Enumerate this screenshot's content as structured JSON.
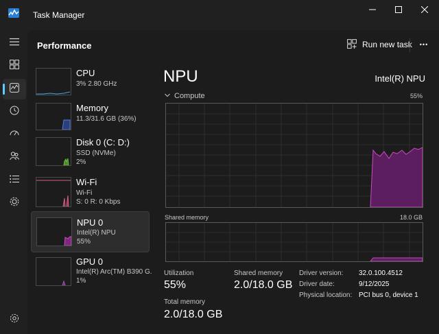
{
  "window": {
    "title": "Task Manager",
    "controls": {
      "minimize": "—",
      "maximize": "☐",
      "close": "✕"
    }
  },
  "nav": {
    "icons": [
      "hamburger-icon",
      "processes-icon",
      "performance-icon",
      "app-history-icon",
      "startup-apps-icon",
      "users-icon",
      "details-icon",
      "services-icon",
      "settings-icon"
    ],
    "active": "performance-icon"
  },
  "header": {
    "title": "Performance",
    "run_task": "Run new task",
    "more": "•••"
  },
  "devices": [
    {
      "name": "CPU",
      "line1": "3%  2.80 GHz",
      "line2": ""
    },
    {
      "name": "Memory",
      "line1": "11.3/31.6 GB (36%)",
      "line2": ""
    },
    {
      "name": "Disk 0 (C: D:)",
      "line1": "SSD (NVMe)",
      "line2": "2%"
    },
    {
      "name": "Wi-Fi",
      "line1": "Wi-Fi",
      "line2": "S: 0  R: 0 Kbps"
    },
    {
      "name": "NPU 0",
      "line1": "Intel(R) NPU",
      "line2": "55%"
    },
    {
      "name": "GPU 0",
      "line1": "Intel(R) Arc(TM) B390 G.",
      "line2": "1%"
    }
  ],
  "selected_device": "NPU 0",
  "detail": {
    "title": "NPU",
    "model": "Intel(R) NPU",
    "compute_label": "Compute",
    "compute_value": "55%",
    "shared_label": "Shared memory",
    "shared_max": "18.0 GB",
    "utilization_label": "Utilization",
    "utilization_value": "55%",
    "shared_memory_label": "Shared memory",
    "shared_memory_value": "2.0/18.0 GB",
    "total_memory_label": "Total memory",
    "total_memory_value": "2.0/18.0 GB",
    "driver": [
      {
        "label": "Driver version:",
        "value": "32.0.100.4512"
      },
      {
        "label": "Driver date:",
        "value": "9/12/2025"
      },
      {
        "label": "Physical location:",
        "value": "PCI bus 0, device 1"
      }
    ]
  },
  "colors": {
    "accent": "#60cdff",
    "npu": "#c74cc3",
    "cpu": "#4aa3df",
    "memory": "#7b5cff",
    "disk": "#6fbf3b",
    "wifi": "#d45c8b",
    "gpu": "#9b59b6"
  }
}
